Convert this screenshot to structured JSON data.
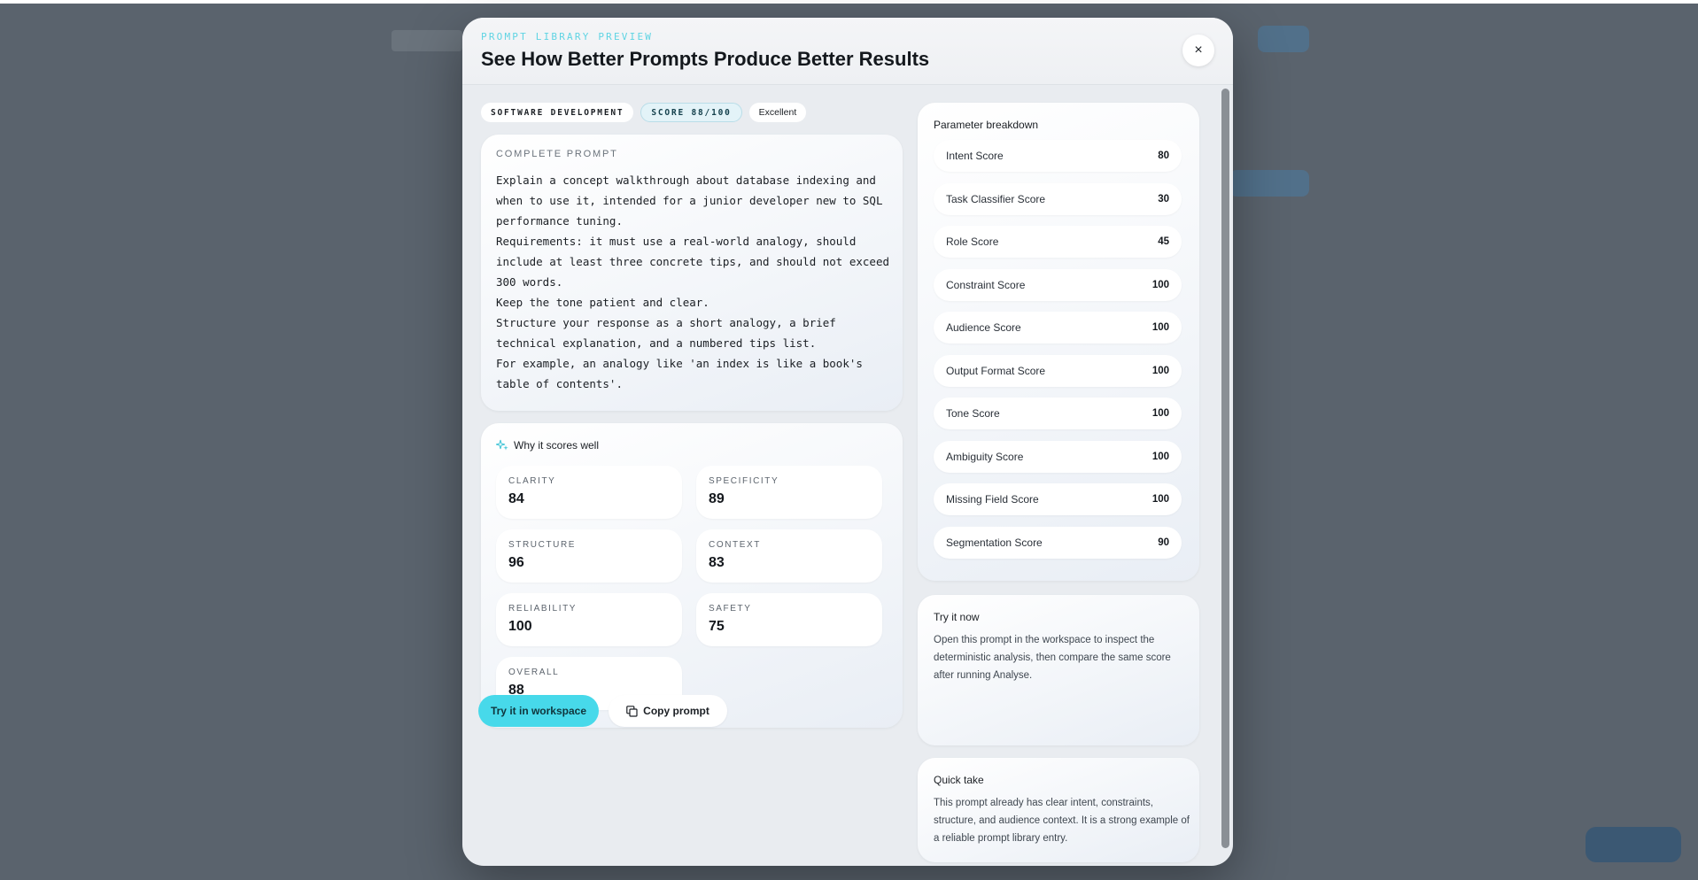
{
  "modal": {
    "eyebrow": "PROMPT LIBRARY PREVIEW",
    "title": "See How Better Prompts Produce Better Results",
    "close_label": "×"
  },
  "tags": {
    "category": "SOFTWARE DEVELOPMENT",
    "score": "SCORE 88/100",
    "rating": "Excellent"
  },
  "prompt": {
    "label": "COMPLETE PROMPT",
    "lines": [
      "Explain a concept walkthrough about database indexing and when to use it, intended for a junior developer new to SQL performance tuning.",
      "Requirements: it must use a real-world analogy, should include at least three concrete tips, and should not exceed 300 words.",
      "Keep the tone patient and clear.",
      "Structure your response as a short analogy, a brief technical explanation, and a numbered tips list.",
      "For example, an analogy like 'an index is like a book's table of contents'."
    ]
  },
  "why": {
    "title": "Why it scores well",
    "icon": "sparkle-icon",
    "metrics": [
      {
        "label": "CLARITY",
        "value": "84"
      },
      {
        "label": "SPECIFICITY",
        "value": "89"
      },
      {
        "label": "STRUCTURE",
        "value": "96"
      },
      {
        "label": "CONTEXT",
        "value": "83"
      },
      {
        "label": "RELIABILITY",
        "value": "100"
      },
      {
        "label": "SAFETY",
        "value": "75"
      },
      {
        "label": "OVERALL",
        "value": "88"
      }
    ]
  },
  "params": {
    "title": "Parameter breakdown",
    "rows": [
      {
        "label": "Intent Score",
        "value": "80"
      },
      {
        "label": "Task Classifier Score",
        "value": "30"
      },
      {
        "label": "Role Score",
        "value": "45"
      },
      {
        "label": "Constraint Score",
        "value": "100"
      },
      {
        "label": "Audience Score",
        "value": "100"
      },
      {
        "label": "Output Format Score",
        "value": "100"
      },
      {
        "label": "Tone Score",
        "value": "100"
      },
      {
        "label": "Ambiguity Score",
        "value": "100"
      },
      {
        "label": "Missing Field Score",
        "value": "100"
      },
      {
        "label": "Segmentation Score",
        "value": "90"
      }
    ]
  },
  "try_now": {
    "title": "Try it now",
    "description": "Open this prompt in the workspace to inspect the deterministic analysis, then compare the same score after running Analyse.",
    "primary_label": "Try it in workspace",
    "secondary_label": "Copy prompt"
  },
  "quick_take": {
    "title": "Quick take",
    "description": "This prompt already has clear intent, constraints, structure, and audience context. It is a strong example of a reliable prompt library entry."
  },
  "colors": {
    "accent": "#47d9ea",
    "eyebrow": "#5fd4e3",
    "backdrop": "#5a636d"
  }
}
